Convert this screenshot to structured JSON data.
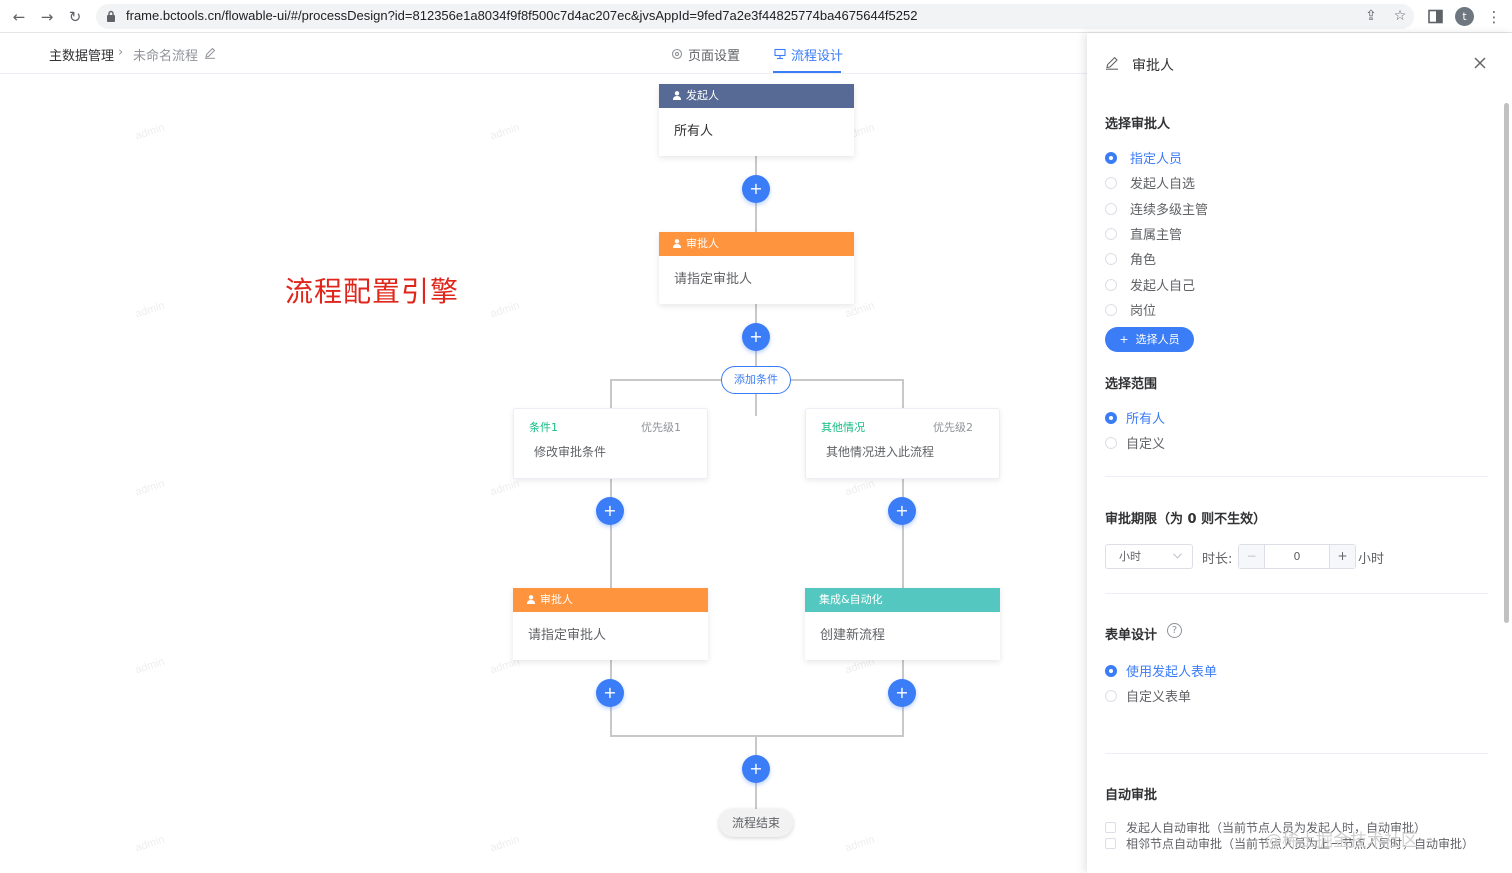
{
  "browser": {
    "url": "frame.bctools.cn/flowable-ui/#/processDesign?id=812356e1a8034f9f8f500c7d4ac207ec&jvsAppId=9fed7a2e3f44825774ba4675644f5252",
    "back": "←",
    "forward": "→",
    "reload": "↻",
    "share": "⇪",
    "star": "☆",
    "avatar": "t",
    "menu": "⋮"
  },
  "header": {
    "breadcrumb_root": "主数据管理",
    "breadcrumb_sep": "›",
    "breadcrumb_current": "未命名流程",
    "tabs": [
      {
        "label": "页面设置",
        "icon": "gear-icon"
      },
      {
        "label": "流程设计",
        "icon": "flow-icon"
      }
    ]
  },
  "canvas": {
    "watermark": "admin",
    "overlay_label": "流程配置引擎",
    "starter_node": {
      "title": "发起人",
      "content": "所有人"
    },
    "approver_node": {
      "title": "审批人",
      "content": "请指定审批人"
    },
    "add_condition": "添加条件",
    "branches": [
      {
        "name": "条件1",
        "priority": "优先级1",
        "desc": "修改审批条件",
        "node": {
          "title": "审批人",
          "content": "请指定审批人"
        }
      },
      {
        "name": "其他情况",
        "priority": "优先级2",
        "desc": "其他情况进入此流程",
        "node": {
          "title": "集成&自动化",
          "content": "创建新流程"
        }
      }
    ],
    "plus": "+",
    "end_label": "流程结束"
  },
  "panel": {
    "title": "审批人",
    "close": "×",
    "approver_section": "选择审批人",
    "approver_options": [
      {
        "label": "指定人员",
        "selected": true
      },
      {
        "label": "发起人自选",
        "selected": false
      },
      {
        "label": "连续多级主管",
        "selected": false
      },
      {
        "label": "直属主管",
        "selected": false
      },
      {
        "label": "角色",
        "selected": false
      },
      {
        "label": "发起人自己",
        "selected": false
      },
      {
        "label": "岗位",
        "selected": false
      }
    ],
    "select_people_button": "选择人员",
    "scope_section": "选择范围",
    "scope_options": [
      {
        "label": "所有人",
        "selected": true
      },
      {
        "label": "自定义",
        "selected": false
      }
    ],
    "deadline_section": "审批期限（为 0 则不生效）",
    "unit_value": "小时",
    "duration_label": "时长:",
    "stepper_minus": "−",
    "stepper_value": "0",
    "stepper_plus": "+",
    "duration_unit": "小时",
    "form_section": "表单设计",
    "help": "?",
    "form_options": [
      {
        "label": "使用发起人表单",
        "selected": true
      },
      {
        "label": "自定义表单",
        "selected": false
      }
    ],
    "auto_section": "自动审批",
    "auto_options": [
      "发起人自动审批（当前节点人员为发起人时，自动审批）",
      "相邻节点自动审批（当前节点人员为上一节点人员时，自动审批）"
    ],
    "footer_watermark": "@稀土掘金技术社区"
  },
  "colors": {
    "accent": "#3b7cf7",
    "starter_header": "#576a95",
    "approver_header": "#ff943e",
    "integration_header": "#54c8c0",
    "condition_name": "#15bc83",
    "overlay_label": "#e0251b"
  }
}
